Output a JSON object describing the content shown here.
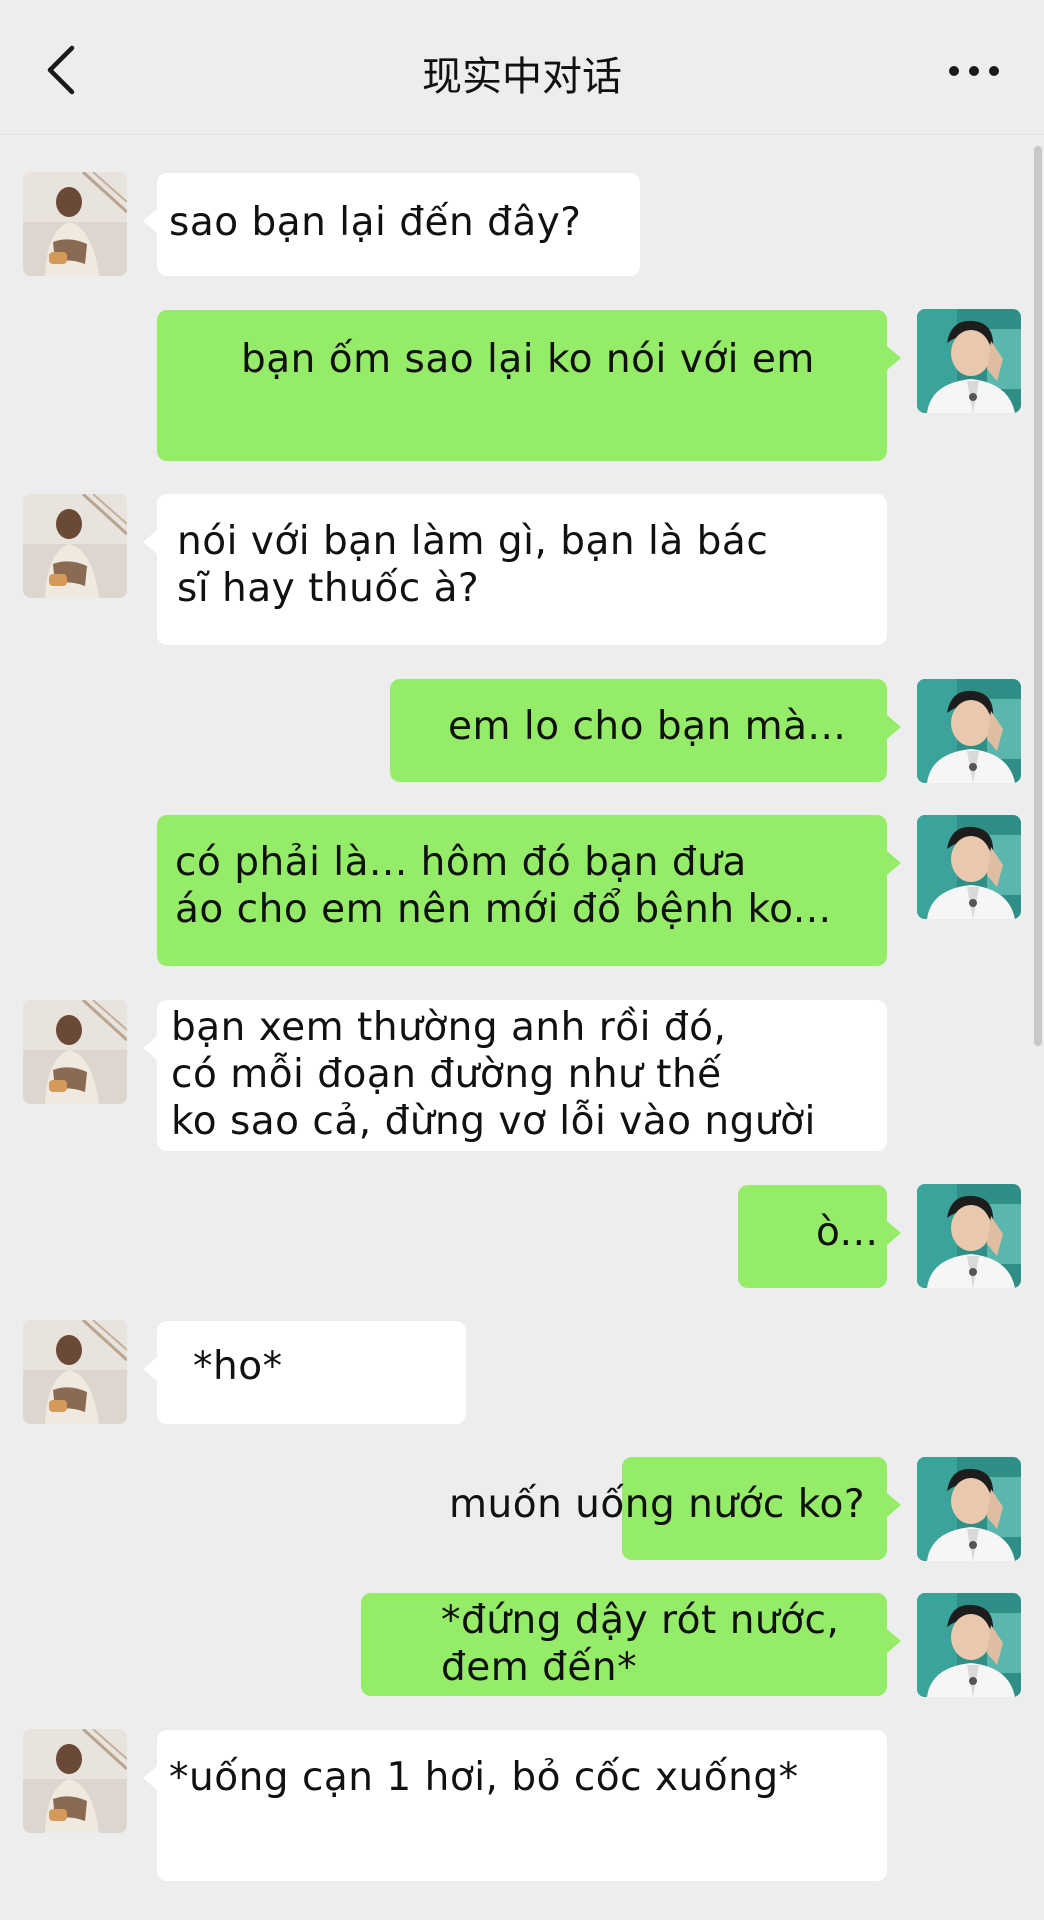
{
  "header": {
    "title": "现实中对话"
  },
  "messages": [
    {
      "side": "left",
      "text": "sao bạn lại đến đây?"
    },
    {
      "side": "right",
      "text": "bạn ốm sao lại ko nói với em"
    },
    {
      "side": "left",
      "text": "nói với bạn làm gì, bạn là bác\nsĩ hay thuốc à?"
    },
    {
      "side": "right",
      "text": "em lo cho bạn mà..."
    },
    {
      "side": "right",
      "text": "có phải là... hôm đó bạn đưa\náo cho em nên mới đổ bệnh ko..."
    },
    {
      "side": "left",
      "text": "bạn xem thường anh rồi đó,\ncó mỗi đoạn đường như thế\nko sao cả, đừng vơ lỗi vào người"
    },
    {
      "side": "right",
      "text": "ò..."
    },
    {
      "side": "left",
      "text": "*ho*"
    },
    {
      "side": "right",
      "text": "muốn uống nước ko?"
    },
    {
      "side": "right",
      "text": "*đứng dậy rót nước,\nđem đến*"
    },
    {
      "side": "left",
      "text": "*uống cạn 1 hơi, bỏ cốc xuống*"
    }
  ]
}
